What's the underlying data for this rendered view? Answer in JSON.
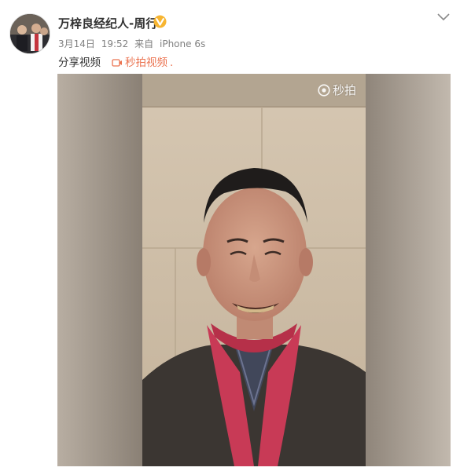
{
  "post": {
    "author_name": "万梓良经纪人-周行",
    "verified_badge_icon": "verified-v-icon",
    "date": "3月14日",
    "time": "19:52",
    "source_prefix": "来自",
    "source_device": "iPhone 6s",
    "text": "分享视频",
    "video_link_label": "秒拍视频",
    "video_link_suffix": "."
  },
  "video": {
    "watermark": "秒拍"
  },
  "colors": {
    "link": "#eb7350",
    "verified": "#f7b531",
    "meta": "#808080"
  }
}
